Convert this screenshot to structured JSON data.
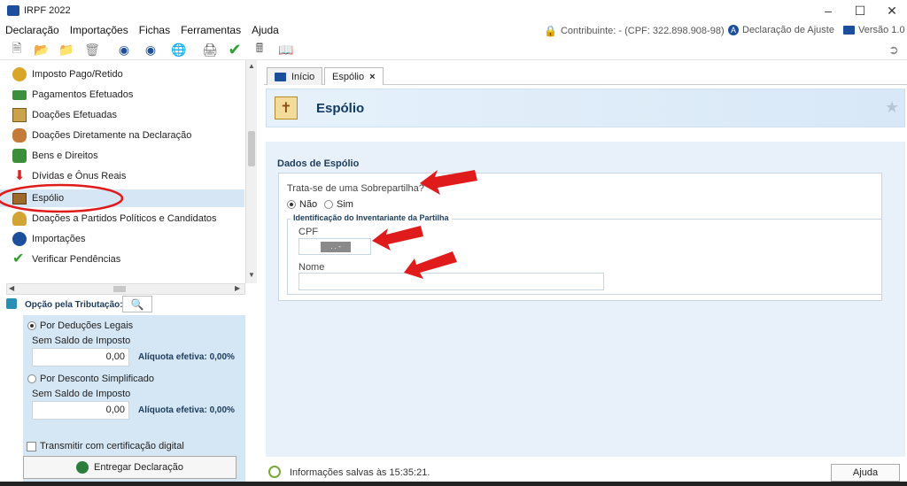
{
  "window": {
    "title": "IRPF 2022",
    "minimize": "–",
    "maximize": "☐",
    "close": "✕"
  },
  "menu": [
    {
      "label": "Declaração"
    },
    {
      "label": "Importações"
    },
    {
      "label": "Fichas"
    },
    {
      "label": "Ferramentas"
    },
    {
      "label": "Ajuda"
    }
  ],
  "menu_right": {
    "contribuinte": "Contribuinte: - (CPF: 322.898.908-98)",
    "declaracao": "Declaração de Ajuste",
    "versao": "Versão 1.0"
  },
  "sidebar": {
    "items": [
      {
        "label": "Imposto Pago/Retido",
        "icon": "money-bag-icon"
      },
      {
        "label": "Pagamentos Efetuados",
        "icon": "credit-card-icon"
      },
      {
        "label": "Doações Efetuadas",
        "icon": "gift-icon"
      },
      {
        "label": "Doações Diretamente na Declaração",
        "icon": "people-icon"
      },
      {
        "label": "Bens e Direitos",
        "icon": "assets-icon"
      },
      {
        "label": "Dívidas e Ônus Reais",
        "icon": "down-arrow-icon"
      },
      {
        "label": "Espólio",
        "icon": "chest-icon"
      },
      {
        "label": "Doações a Partidos Políticos e Candidatos",
        "icon": "party-icon"
      },
      {
        "label": "Importações",
        "icon": "globe-icon"
      },
      {
        "label": "Verificar Pendências",
        "icon": "check-icon"
      }
    ]
  },
  "tributacao": {
    "label": "Opção pela Tributação:",
    "deducoes_label": "Por Deduções Legais",
    "deducoes_saldo": "Sem Saldo de Imposto",
    "deducoes_valor": "0,00",
    "deducoes_aliquota": "Alíquota efetiva: 0,00%",
    "simplificado_label": "Por Desconto Simplificado",
    "simplificado_saldo": "Sem Saldo de Imposto",
    "simplificado_valor": "0,00",
    "simplificado_aliquota": "Alíquota efetiva: 0,00%",
    "certificado_label": "Transmitir com certificação digital",
    "entregar_label": "Entregar Declaração"
  },
  "tabs": [
    {
      "label": "Início"
    },
    {
      "label": "Espólio",
      "close": "×"
    }
  ],
  "page": {
    "title": "Espólio",
    "section_title": "Dados de Espólio",
    "question": "Trata-se de uma Sobrepartilha?",
    "option_nao": "Não",
    "option_sim": "Sim",
    "group_title": "Identificação do Inventariante da Partilha",
    "cpf_label": "CPF",
    "cpf_value": ".  .  -",
    "nome_label": "Nome",
    "nome_value": ""
  },
  "status": {
    "message": "Informações salvas às 15:35:21.",
    "help_label": "Ajuda"
  },
  "colors": {
    "accent": "#1d4e9b",
    "highlight_red": "#e01b1b",
    "panel_blue": "#d5e6f4"
  }
}
